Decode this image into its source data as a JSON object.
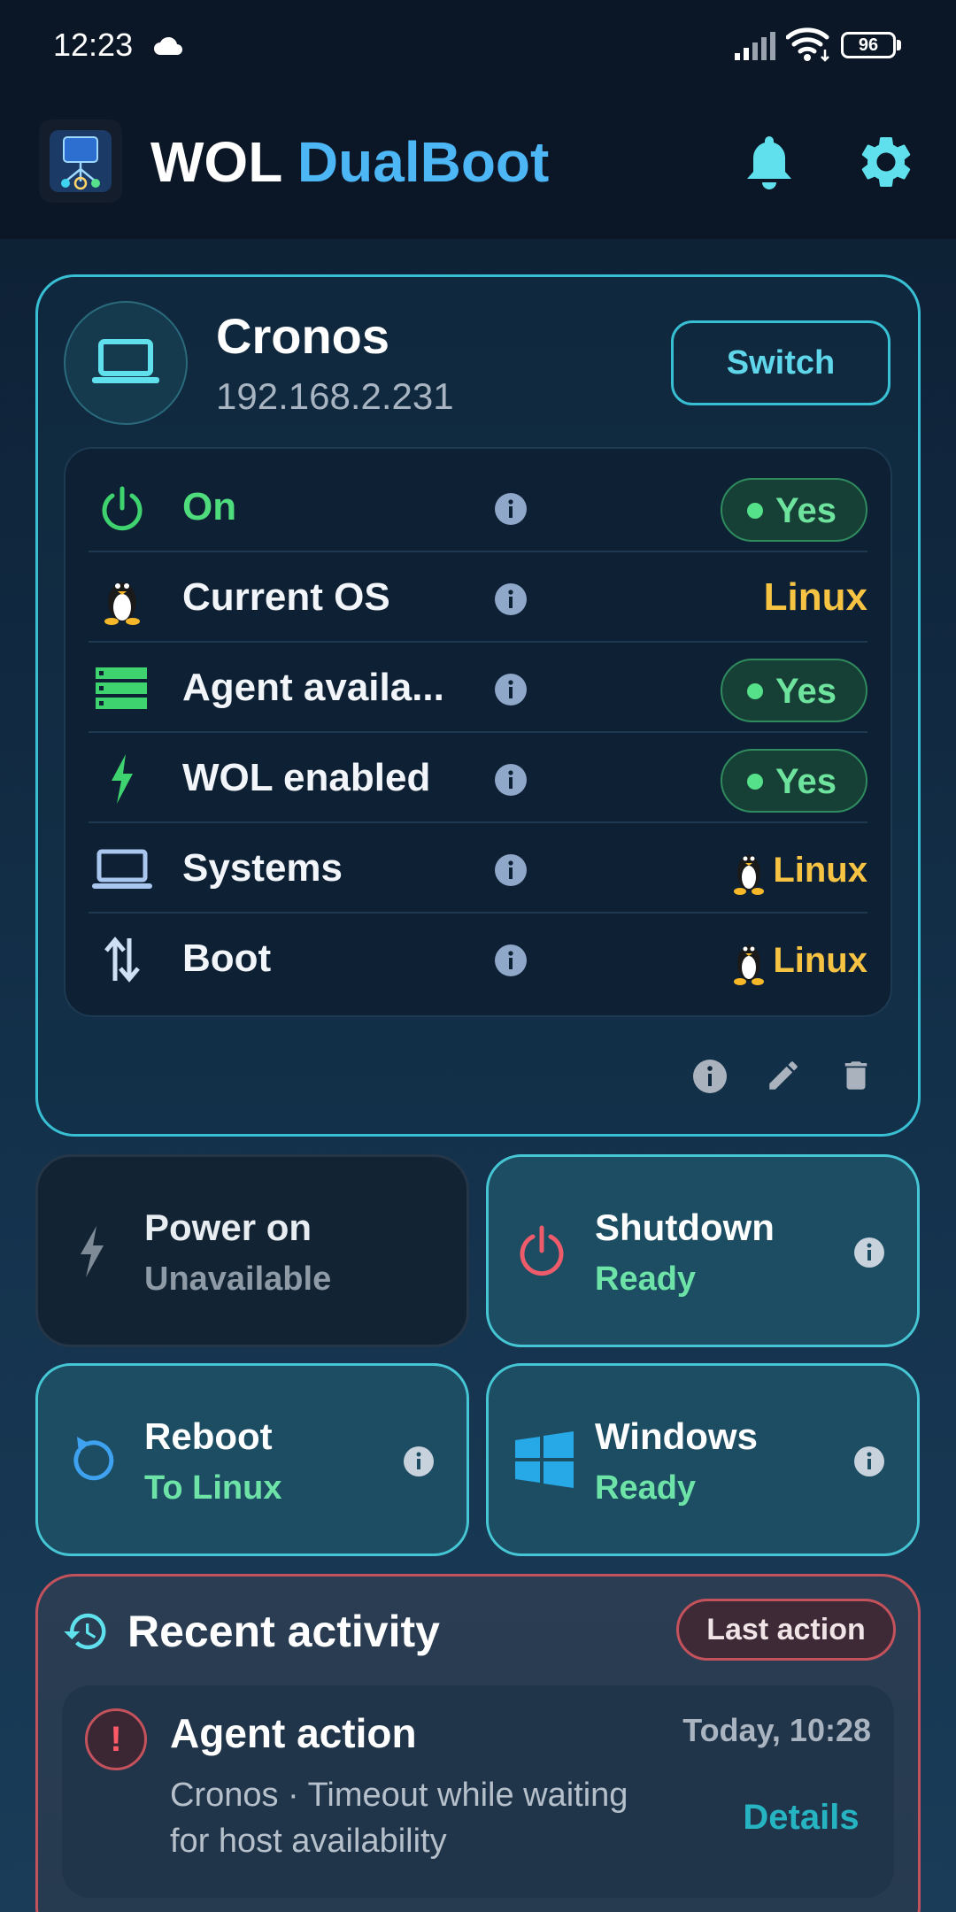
{
  "status_bar": {
    "time": "12:23",
    "battery": "96"
  },
  "app": {
    "title_part1": "WOL",
    "title_part2": "DualBoot"
  },
  "device": {
    "name": "Cronos",
    "ip": "192.168.2.231",
    "switch_label": "Switch",
    "rows": [
      {
        "label": "On",
        "value": "Yes",
        "kind": "pill"
      },
      {
        "label": "Current OS",
        "value": "Linux",
        "kind": "text"
      },
      {
        "label": "Agent availa...",
        "value": "Yes",
        "kind": "pill"
      },
      {
        "label": "WOL enabled",
        "value": "Yes",
        "kind": "pill"
      },
      {
        "label": "Systems",
        "value": "Linux",
        "kind": "tux"
      },
      {
        "label": "Boot",
        "value": "Linux",
        "kind": "tux"
      }
    ]
  },
  "actions": {
    "power_on": {
      "title": "Power on",
      "subtitle": "Unavailable"
    },
    "shutdown": {
      "title": "Shutdown",
      "subtitle": "Ready"
    },
    "reboot": {
      "title": "Reboot",
      "subtitle": "To Linux"
    },
    "windows": {
      "title": "Windows",
      "subtitle": "Ready"
    }
  },
  "recent": {
    "title": "Recent activity",
    "badge": "Last action",
    "item": {
      "icon_text": "!",
      "title": "Agent action",
      "time": "Today, 10:28",
      "description": "Cronos · Timeout while waiting for host availability",
      "details_label": "Details"
    }
  },
  "colors": {
    "accent": "#38bfd4",
    "brand_blue": "#4db6f5",
    "success": "#55e08a",
    "linux": "#f6c343",
    "danger": "#c4525c"
  }
}
